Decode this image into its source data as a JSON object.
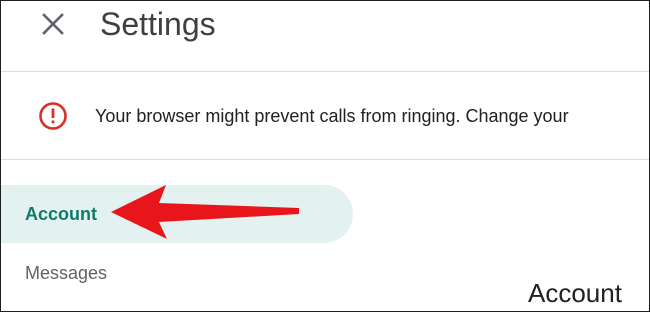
{
  "header": {
    "title": "Settings",
    "close_icon": "close-icon"
  },
  "banner": {
    "icon": "error-outline-icon",
    "icon_color": "#d93025",
    "text": "Your browser might prevent calls from ringing. Change your"
  },
  "sidebar": {
    "items": [
      {
        "label": "Account",
        "selected": true
      },
      {
        "label": "Messages",
        "selected": false
      }
    ],
    "selected_bg": "#e3f1f0",
    "selected_color": "#127a6a"
  },
  "main": {
    "section_title": "Account"
  },
  "annotation": {
    "arrow_color": "#e8161b",
    "arrow_icon": "red-arrow-annotation"
  }
}
